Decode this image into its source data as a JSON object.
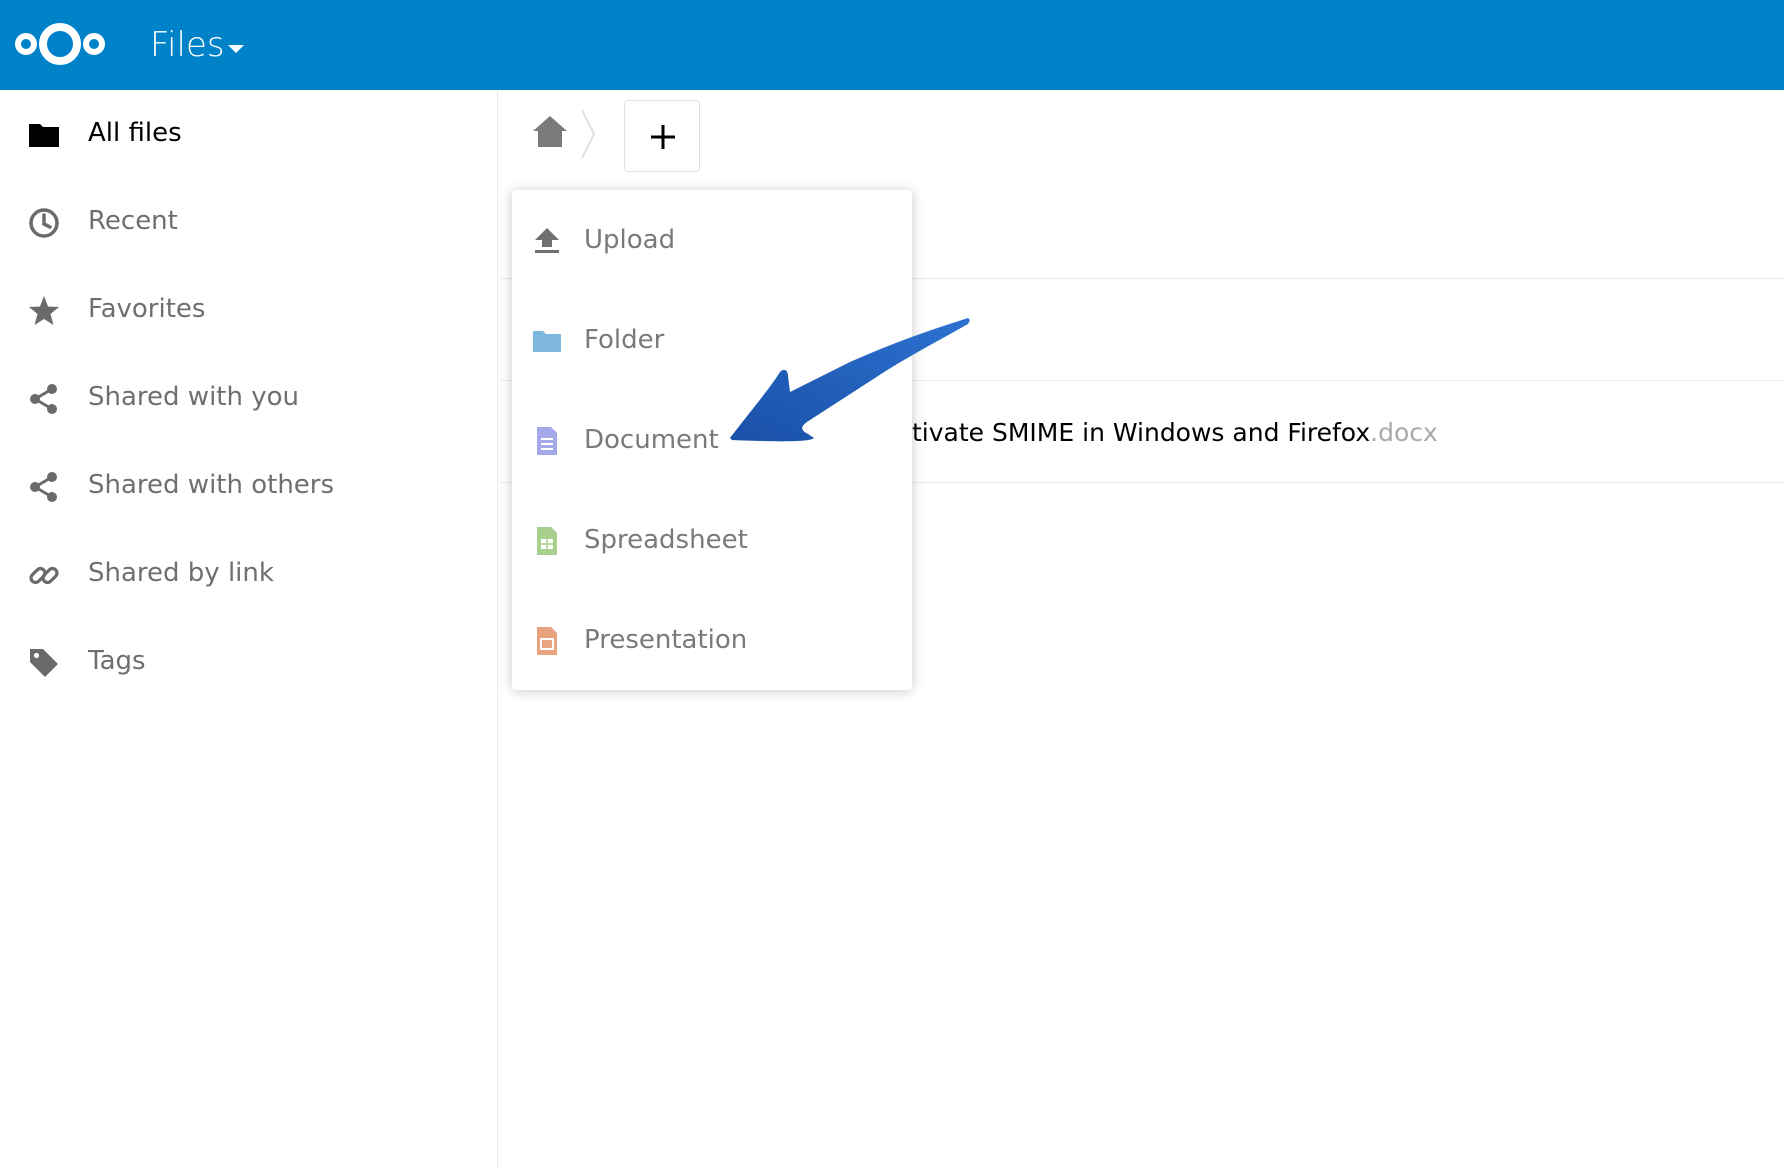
{
  "header": {
    "app_title": "Files",
    "brand_color": "#0082c9",
    "logo_icon": "nextcloud-logo",
    "menu_icon": "caret-down-icon"
  },
  "sidebar": {
    "items": [
      {
        "label": "All files",
        "icon": "folder-icon",
        "active": true
      },
      {
        "label": "Recent",
        "icon": "clock-icon",
        "active": false
      },
      {
        "label": "Favorites",
        "icon": "star-icon",
        "active": false
      },
      {
        "label": "Shared with you",
        "icon": "share-icon",
        "active": false
      },
      {
        "label": "Shared with others",
        "icon": "share-icon",
        "active": false
      },
      {
        "label": "Shared by link",
        "icon": "link-icon",
        "active": false
      },
      {
        "label": "Tags",
        "icon": "tag-icon",
        "active": false
      }
    ]
  },
  "breadcrumb": {
    "home_icon": "home-icon",
    "new_button_icon": "plus-icon"
  },
  "new_menu": {
    "items": [
      {
        "label": "Upload",
        "icon": "upload-icon",
        "color": "#707070"
      },
      {
        "label": "Folder",
        "icon": "folder-icon",
        "color": "#7eb8e0"
      },
      {
        "label": "Document",
        "icon": "document-icon",
        "color": "#a3a9e6"
      },
      {
        "label": "Spreadsheet",
        "icon": "spreadsheet-icon",
        "color": "#a8cf8d"
      },
      {
        "label": "Presentation",
        "icon": "presentation-icon",
        "color": "#e8a47f"
      }
    ]
  },
  "files": [
    {
      "name_visible": "tivate SMIME in Windows and Firefox",
      "extension": ".docx"
    }
  ],
  "annotation": {
    "icon": "pointer-arrow-annotation",
    "color": "#1f5fb8"
  }
}
